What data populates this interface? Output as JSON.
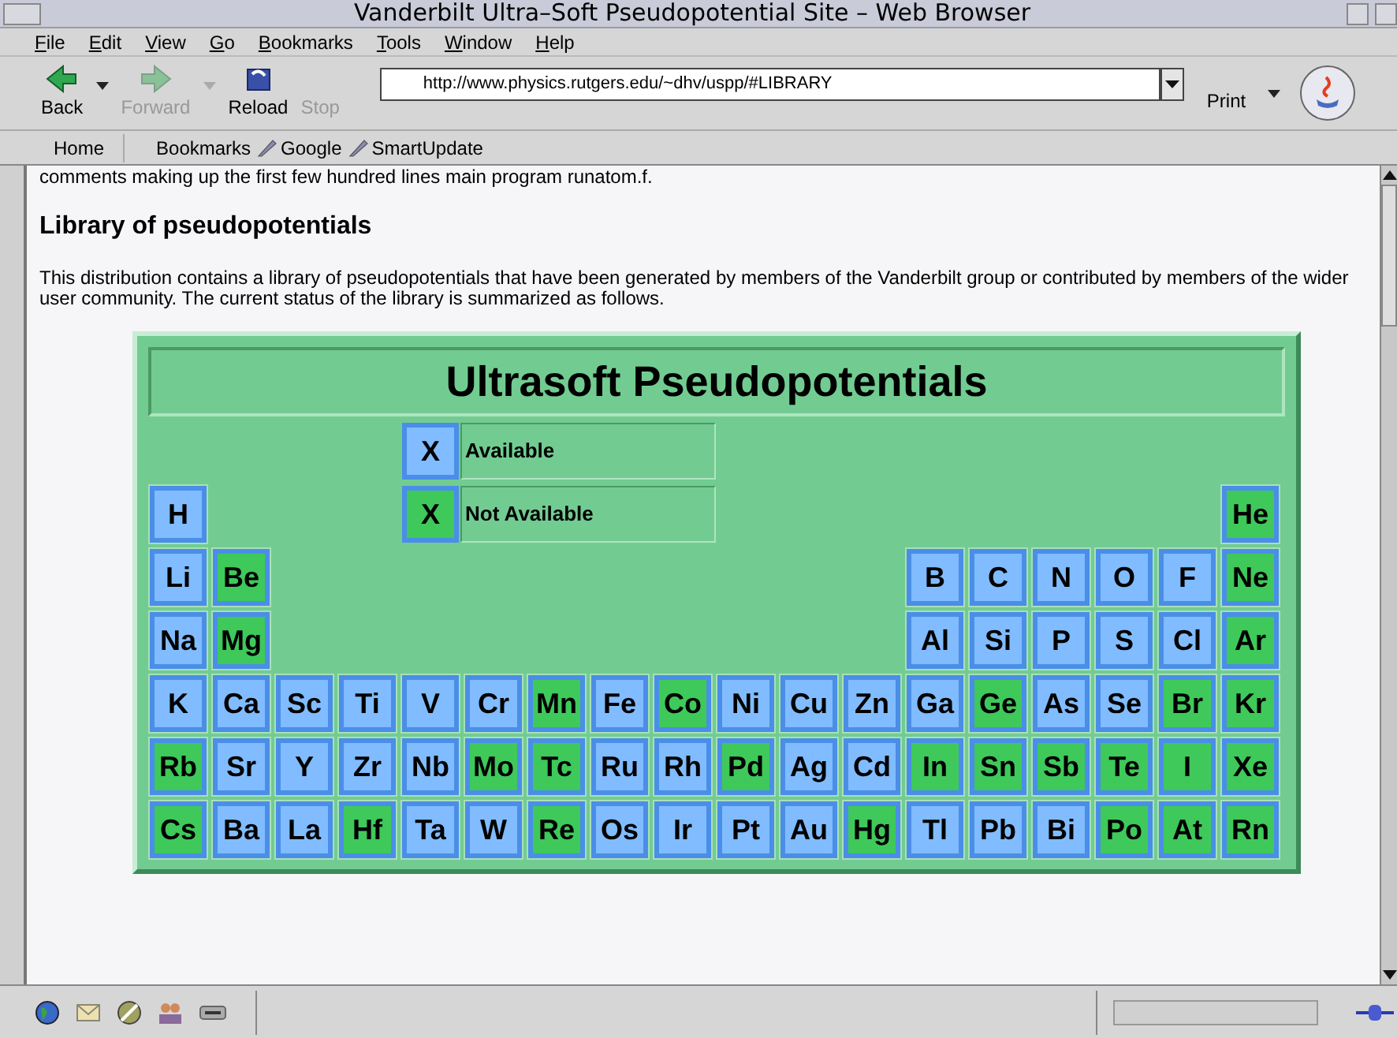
{
  "window": {
    "title": "Vanderbilt Ultra–Soft Pseudopotential Site – Web Browser"
  },
  "menu": [
    "File",
    "Edit",
    "View",
    "Go",
    "Bookmarks",
    "Tools",
    "Window",
    "Help"
  ],
  "toolbar": {
    "buttons": [
      {
        "kind": "back",
        "label": "Back",
        "disabled": false
      },
      {
        "kind": "forward",
        "label": "Forward",
        "disabled": true
      },
      {
        "kind": "reload",
        "label": "Reload",
        "disabled": false
      },
      {
        "kind": "stop",
        "label": "Stop",
        "disabled": true
      }
    ],
    "url": "http://www.physics.rutgers.edu/~dhv/uspp/#LIBRARY",
    "print": "Print"
  },
  "personal_toolbar": {
    "home": "Home",
    "items": [
      {
        "kind": "folder",
        "label": "Bookmarks"
      },
      {
        "kind": "link",
        "label": "Google"
      },
      {
        "kind": "link",
        "label": "SmartUpdate"
      }
    ]
  },
  "content": {
    "intro": "comments making up the first few hundred lines main program runatom.f.",
    "heading": "Library of pseudopotentials",
    "paragraph": "This distribution contains a library of pseudopotentials that have been generated by members of the Vanderbilt group or contributed by members of the wider user community. The current status of the library is summarized as follows.",
    "table": {
      "title": "Ultrasoft Pseudopotentials",
      "legend": [
        {
          "mark": "X",
          "available": true,
          "label": "Available"
        },
        {
          "mark": "X",
          "available": false,
          "label": "Not Available"
        }
      ],
      "rows": [
        [
          {
            "symbol": "H",
            "available": true
          },
          null,
          null,
          null,
          null,
          null,
          null,
          null,
          null,
          null,
          null,
          null,
          null,
          null,
          null,
          null,
          null,
          {
            "symbol": "He",
            "available": false
          }
        ],
        [
          {
            "symbol": "Li",
            "available": true
          },
          {
            "symbol": "Be",
            "available": false
          },
          null,
          null,
          null,
          null,
          null,
          null,
          null,
          null,
          null,
          null,
          {
            "symbol": "B",
            "available": true
          },
          {
            "symbol": "C",
            "available": true
          },
          {
            "symbol": "N",
            "available": true
          },
          {
            "symbol": "O",
            "available": true
          },
          {
            "symbol": "F",
            "available": true
          },
          {
            "symbol": "Ne",
            "available": false
          }
        ],
        [
          {
            "symbol": "Na",
            "available": true
          },
          {
            "symbol": "Mg",
            "available": false
          },
          null,
          null,
          null,
          null,
          null,
          null,
          null,
          null,
          null,
          null,
          {
            "symbol": "Al",
            "available": true
          },
          {
            "symbol": "Si",
            "available": true
          },
          {
            "symbol": "P",
            "available": true
          },
          {
            "symbol": "S",
            "available": true
          },
          {
            "symbol": "Cl",
            "available": true
          },
          {
            "symbol": "Ar",
            "available": false
          }
        ],
        [
          {
            "symbol": "K",
            "available": true
          },
          {
            "symbol": "Ca",
            "available": true
          },
          {
            "symbol": "Sc",
            "available": true
          },
          {
            "symbol": "Ti",
            "available": true
          },
          {
            "symbol": "V",
            "available": true
          },
          {
            "symbol": "Cr",
            "available": true
          },
          {
            "symbol": "Mn",
            "available": false
          },
          {
            "symbol": "Fe",
            "available": true
          },
          {
            "symbol": "Co",
            "available": false
          },
          {
            "symbol": "Ni",
            "available": true
          },
          {
            "symbol": "Cu",
            "available": true
          },
          {
            "symbol": "Zn",
            "available": true
          },
          {
            "symbol": "Ga",
            "available": true
          },
          {
            "symbol": "Ge",
            "available": false
          },
          {
            "symbol": "As",
            "available": true
          },
          {
            "symbol": "Se",
            "available": true
          },
          {
            "symbol": "Br",
            "available": false
          },
          {
            "symbol": "Kr",
            "available": false
          }
        ],
        [
          {
            "symbol": "Rb",
            "available": false
          },
          {
            "symbol": "Sr",
            "available": true
          },
          {
            "symbol": "Y",
            "available": true
          },
          {
            "symbol": "Zr",
            "available": true
          },
          {
            "symbol": "Nb",
            "available": true
          },
          {
            "symbol": "Mo",
            "available": false
          },
          {
            "symbol": "Tc",
            "available": false
          },
          {
            "symbol": "Ru",
            "available": true
          },
          {
            "symbol": "Rh",
            "available": true
          },
          {
            "symbol": "Pd",
            "available": false
          },
          {
            "symbol": "Ag",
            "available": true
          },
          {
            "symbol": "Cd",
            "available": true
          },
          {
            "symbol": "In",
            "available": false
          },
          {
            "symbol": "Sn",
            "available": false
          },
          {
            "symbol": "Sb",
            "available": false
          },
          {
            "symbol": "Te",
            "available": false
          },
          {
            "symbol": "I",
            "available": false
          },
          {
            "symbol": "Xe",
            "available": false
          }
        ],
        [
          {
            "symbol": "Cs",
            "available": false
          },
          {
            "symbol": "Ba",
            "available": true
          },
          {
            "symbol": "La",
            "available": true
          },
          {
            "symbol": "Hf",
            "available": false
          },
          {
            "symbol": "Ta",
            "available": true
          },
          {
            "symbol": "W",
            "available": true
          },
          {
            "symbol": "Re",
            "available": false
          },
          {
            "symbol": "Os",
            "available": true
          },
          {
            "symbol": "Ir",
            "available": true
          },
          {
            "symbol": "Pt",
            "available": true
          },
          {
            "symbol": "Au",
            "available": true
          },
          {
            "symbol": "Hg",
            "available": false
          },
          {
            "symbol": "Tl",
            "available": true
          },
          {
            "symbol": "Pb",
            "available": true
          },
          {
            "symbol": "Bi",
            "available": true
          },
          {
            "symbol": "Po",
            "available": false
          },
          {
            "symbol": "At",
            "available": false
          },
          {
            "symbol": "Rn",
            "available": false
          }
        ]
      ]
    }
  }
}
